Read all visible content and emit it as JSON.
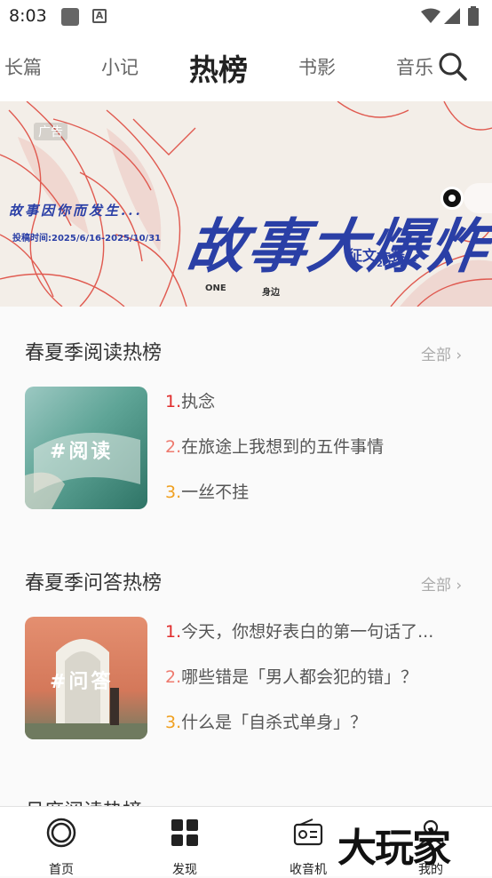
{
  "status_bar": {
    "time": "8:03"
  },
  "top_nav": {
    "tabs": [
      {
        "label": "长篇",
        "active": false
      },
      {
        "label": "小记",
        "active": false
      },
      {
        "label": "热榜",
        "active": true
      },
      {
        "label": "书影",
        "active": false
      },
      {
        "label": "音乐",
        "active": false
      }
    ]
  },
  "banner": {
    "ad_label": "广告",
    "tagline": "故事因你而发生...",
    "date": "投稿时间:2025/6/16-2025/10/31",
    "headline": "故事大爆炸",
    "contest": "征文大赛",
    "year": "2025",
    "sponsor_one": "ONE",
    "sponsor_two": "身边"
  },
  "sections": [
    {
      "title": "春夏季阅读热榜",
      "more": "全部",
      "thumb_label": "#阅读",
      "items": [
        {
          "rank": "1.",
          "text": "执念"
        },
        {
          "rank": "2.",
          "text": "在旅途上我想到的五件事情"
        },
        {
          "rank": "3.",
          "text": "一丝不挂"
        }
      ]
    },
    {
      "title": "春夏季问答热榜",
      "more": "全部",
      "thumb_label": "#问答",
      "items": [
        {
          "rank": "1.",
          "text": "今天，你想好表白的第一句话了..."
        },
        {
          "rank": "2.",
          "text": "哪些错是「男人都会犯的错」？"
        },
        {
          "rank": "3.",
          "text": "什么是「自杀式单身」？"
        }
      ]
    }
  ],
  "partial_section_title": "月度阅读热榜",
  "bottom_nav": {
    "items": [
      {
        "label": "首页",
        "icon": "home-icon"
      },
      {
        "label": "发现",
        "icon": "grid-icon"
      },
      {
        "label": "收音机",
        "icon": "radio-icon"
      },
      {
        "label": "我的",
        "icon": "profile-icon"
      }
    ]
  },
  "watermark": "大玩家"
}
